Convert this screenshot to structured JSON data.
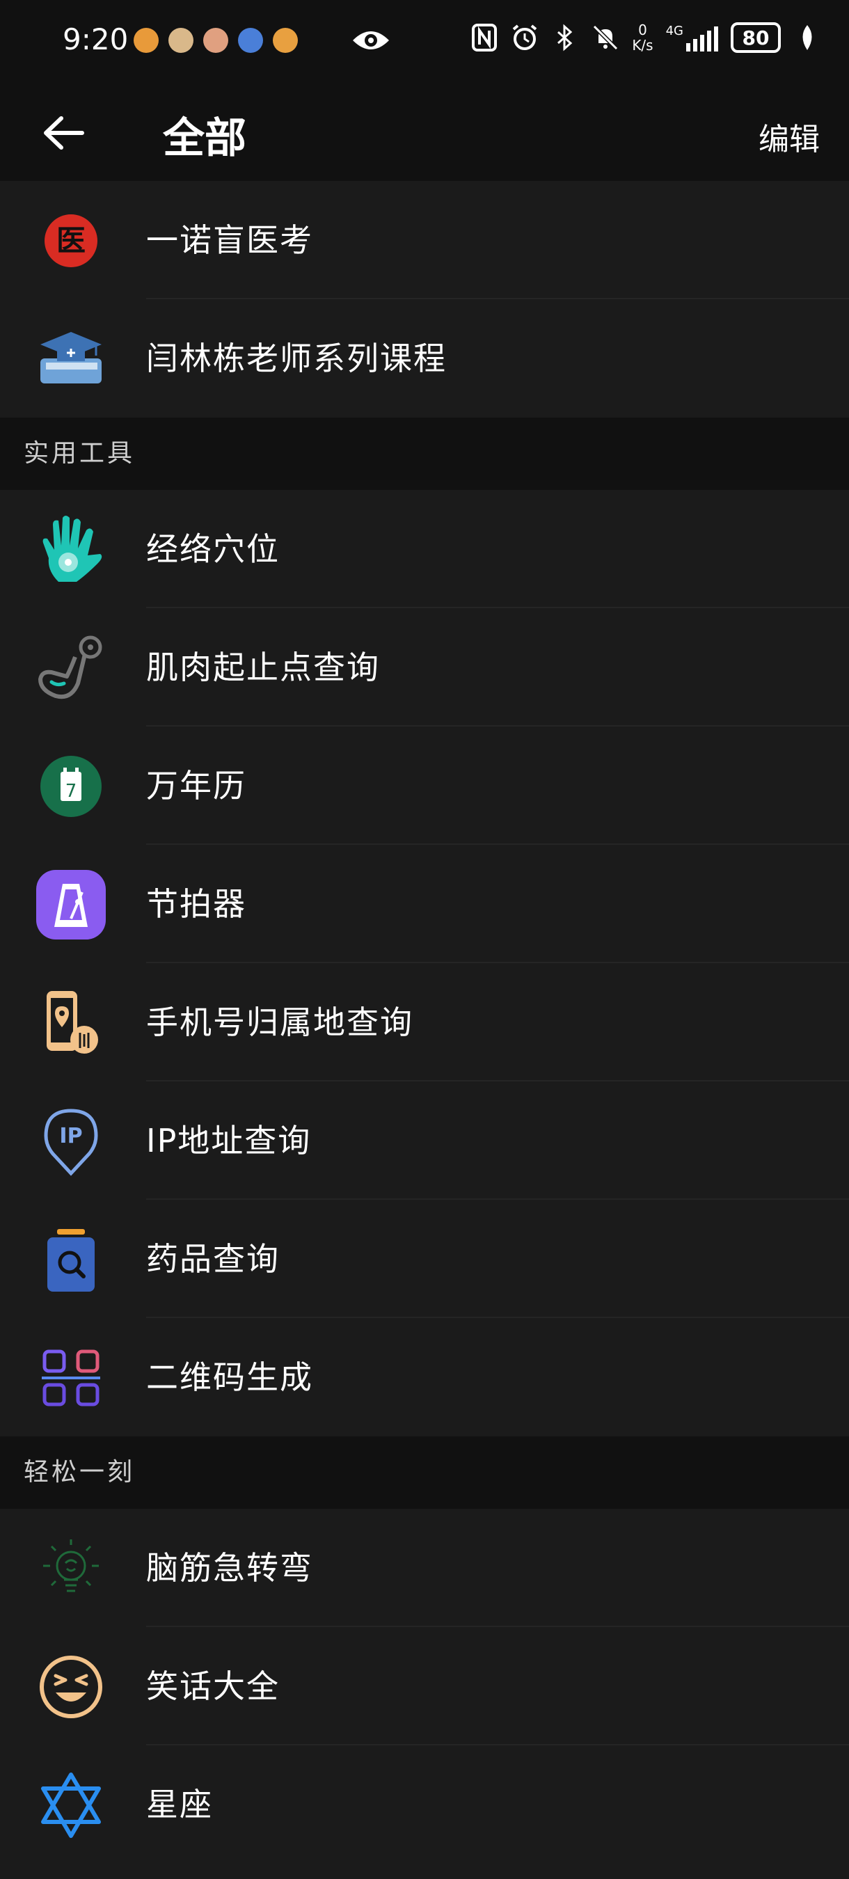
{
  "status": {
    "time": "9:20",
    "battery": "80",
    "net_speed": "0\nK/s",
    "net_type": "4G"
  },
  "header": {
    "title": "全部",
    "edit_label": "编辑"
  },
  "top_items": [
    {
      "label": "一诺盲医考",
      "icon": "medical-exam-icon"
    },
    {
      "label": "闫林栋老师系列课程",
      "icon": "graduation-book-icon"
    }
  ],
  "sections": [
    {
      "title": "实用工具",
      "items": [
        {
          "label": "经络穴位",
          "icon": "hand-acupoint-icon"
        },
        {
          "label": "肌肉起止点查询",
          "icon": "muscle-arm-icon"
        },
        {
          "label": "万年历",
          "icon": "calendar-icon"
        },
        {
          "label": "节拍器",
          "icon": "metronome-icon"
        },
        {
          "label": "手机号归属地查询",
          "icon": "phone-location-icon"
        },
        {
          "label": "IP地址查询",
          "icon": "ip-location-icon"
        },
        {
          "label": "药品查询",
          "icon": "medicine-search-icon"
        },
        {
          "label": "二维码生成",
          "icon": "qr-code-icon"
        }
      ]
    },
    {
      "title": "轻松一刻",
      "items": [
        {
          "label": "脑筋急转弯",
          "icon": "lightbulb-brain-icon"
        },
        {
          "label": "笑话大全",
          "icon": "laughing-face-icon"
        },
        {
          "label": "星座",
          "icon": "star-of-david-icon"
        }
      ]
    }
  ]
}
